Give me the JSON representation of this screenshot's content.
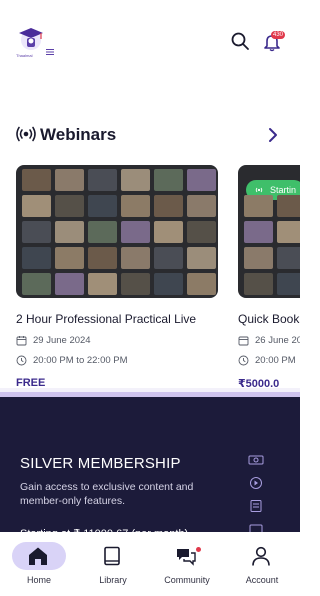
{
  "header": {
    "logo_text": "Thaalmal",
    "notification_count": "430"
  },
  "webinars": {
    "title": "Webinars",
    "cards": [
      {
        "title": "2 Hour Professional Practical Live",
        "date": "29 June 2024",
        "time": "20:00 PM to 22:00 PM",
        "price": "FREE"
      },
      {
        "title": "Quick Book",
        "date": "26 June 20",
        "time": "20:00 PM",
        "price": "₹5000.0",
        "live_label": "Startin"
      }
    ]
  },
  "membership": {
    "title": "SILVER MEMBERSHIP",
    "description": "Gain access to exclusive content and member-only features.",
    "price_cut": "Starting at ₹ 11000.67 (per month)"
  },
  "bottom_nav": {
    "items": [
      {
        "label": "Home",
        "icon": "home-icon",
        "active": true
      },
      {
        "label": "Library",
        "icon": "book-icon",
        "active": false
      },
      {
        "label": "Community",
        "icon": "chat-icon",
        "active": false
      },
      {
        "label": "Account",
        "icon": "person-icon",
        "active": false
      }
    ]
  },
  "colors": {
    "accent": "#3b2a8c",
    "nav_pill": "#d9d3f7",
    "membership_bg": "#1c1b3a",
    "live_green": "#3fbf6a",
    "badge_red": "#e0394b"
  }
}
